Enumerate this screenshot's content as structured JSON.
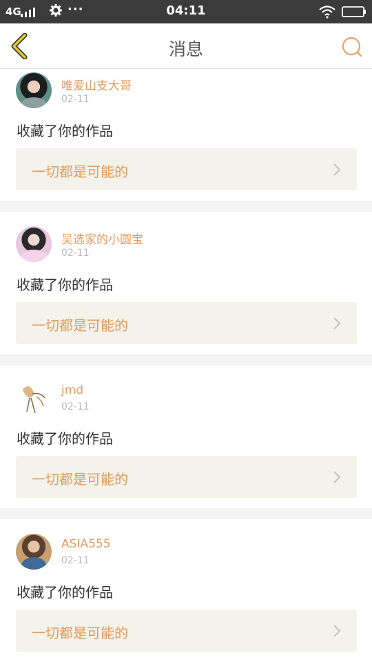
{
  "status_bar": {
    "network": "4G",
    "more_dots": "···",
    "time": "04:11"
  },
  "header": {
    "title": "消息",
    "back_icon": "chevron-left-icon",
    "search_icon": "search-icon"
  },
  "colors": {
    "accent": "#e49a5c",
    "back_icon": "#d4b51a",
    "work_box_bg": "#f3f3eb",
    "divider": "#f4f4f4"
  },
  "messages": [
    {
      "username": "唯爱山支大哥",
      "date": "02-11",
      "action": "收藏了你的作品",
      "work_title": "一切都是可能的"
    },
    {
      "username": "吴选家的小圆宝",
      "date": "02-11",
      "action": "收藏了你的作品",
      "work_title": "一切都是可能的"
    },
    {
      "username": "jmd",
      "date": "02-11",
      "action": "收藏了你的作品",
      "work_title": "一切都是可能的"
    },
    {
      "username": "ASIA555",
      "date": "02-11",
      "action": "收藏了你的作品",
      "work_title": "一切都是可能的"
    }
  ]
}
